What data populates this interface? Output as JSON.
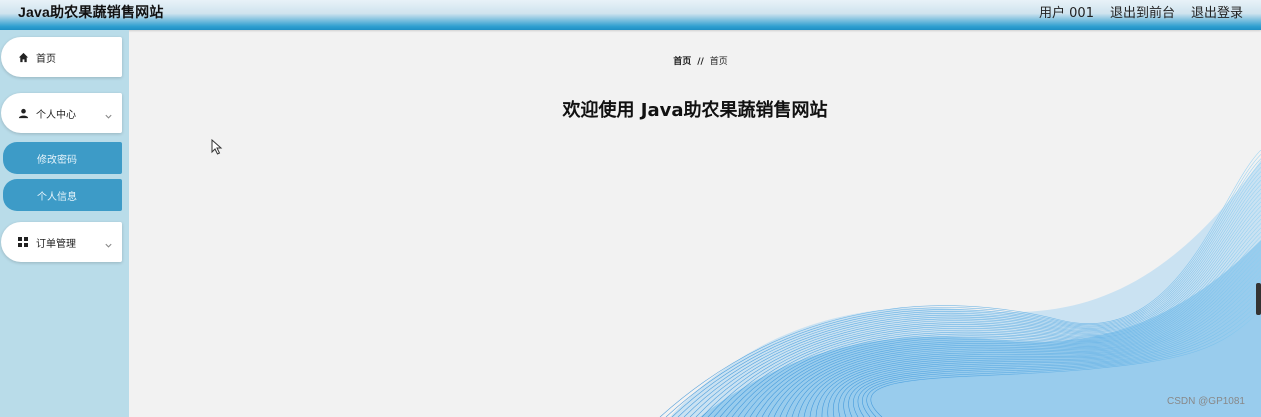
{
  "header": {
    "title": "Java助农果蔬销售网站",
    "user_label": "用户 001",
    "to_frontend": "退出到前台",
    "logout": "退出登录"
  },
  "sidebar": {
    "items": [
      {
        "label": "首页",
        "icon": "home-icon"
      },
      {
        "label": "个人中心",
        "icon": "user-icon",
        "expanded": true,
        "children": [
          {
            "label": "修改密码"
          },
          {
            "label": "个人信息"
          }
        ]
      },
      {
        "label": "订单管理",
        "icon": "grid-icon"
      }
    ]
  },
  "main": {
    "breadcrumb": [
      "首页",
      "首页"
    ],
    "breadcrumb_separator": "//",
    "welcome": "欢迎使用 Java助农果蔬销售网站"
  },
  "watermark": "CSDN @GP1081",
  "colors": {
    "header_accent": "#1e8fc4",
    "sidebar_bg": "#b9dce9",
    "submenu_bg": "#3d9bc7",
    "wave": "#3a9fdc"
  }
}
